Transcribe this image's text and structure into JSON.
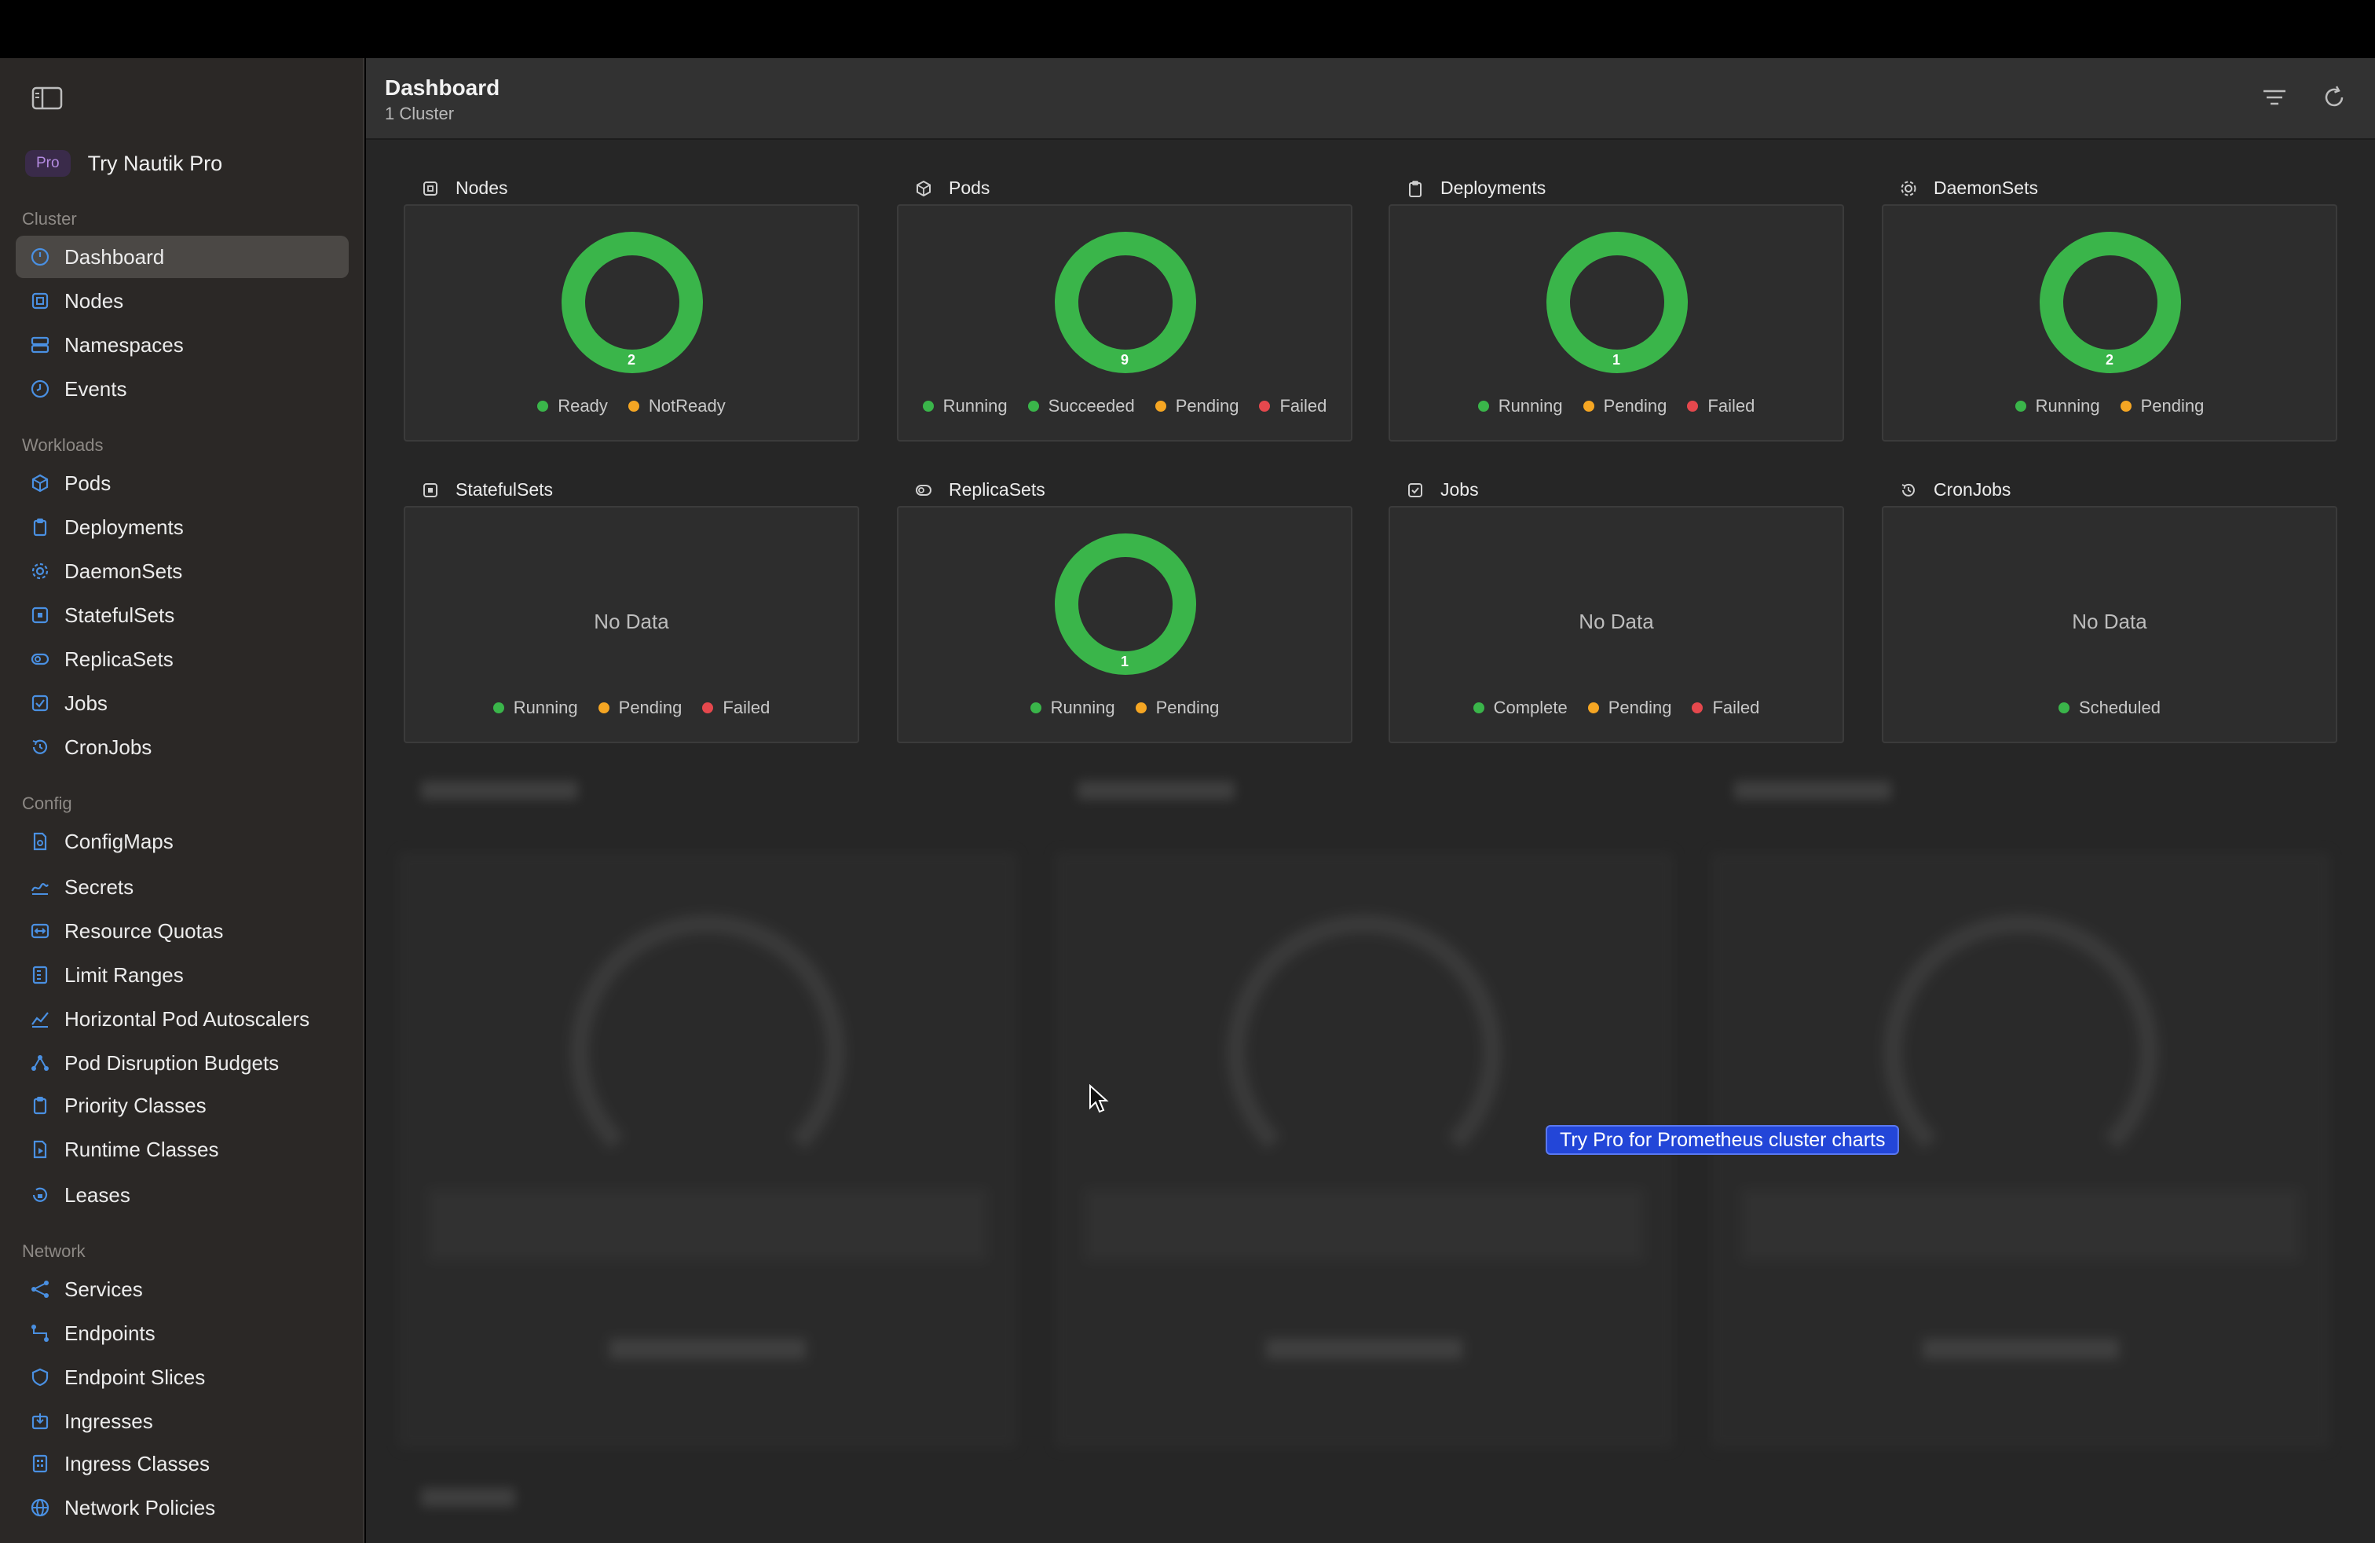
{
  "sidebar": {
    "pro_badge": "Pro",
    "pro_text": "Try Nautik Pro",
    "sections": {
      "cluster": "Cluster",
      "workloads": "Workloads",
      "config": "Config",
      "network": "Network"
    },
    "items": {
      "dashboard": "Dashboard",
      "nodes": "Nodes",
      "namespaces": "Namespaces",
      "events": "Events",
      "pods": "Pods",
      "deployments": "Deployments",
      "daemonsets": "DaemonSets",
      "statefulsets": "StatefulSets",
      "replicasets": "ReplicaSets",
      "jobs": "Jobs",
      "cronjobs": "CronJobs",
      "configmaps": "ConfigMaps",
      "secrets": "Secrets",
      "resource_quotas": "Resource Quotas",
      "limit_ranges": "Limit Ranges",
      "hpa": "Horizontal Pod Autoscalers",
      "pdb": "Pod Disruption Budgets",
      "priority_classes": "Priority Classes",
      "runtime_classes": "Runtime Classes",
      "leases": "Leases",
      "services": "Services",
      "endpoints": "Endpoints",
      "endpoint_slices": "Endpoint Slices",
      "ingresses": "Ingresses",
      "ingress_classes": "Ingress Classes",
      "network_policies": "Network Policies"
    },
    "active": "dashboard"
  },
  "header": {
    "title": "Dashboard",
    "subtitle": "1 Cluster"
  },
  "colors": {
    "green": "#3ab54a",
    "orange": "#f5a623",
    "red": "#e5484d",
    "accent_blue": "#2346d8"
  },
  "cards": {
    "nodes": {
      "title": "Nodes",
      "count": "2",
      "legend": [
        "Ready",
        "NotReady"
      ]
    },
    "pods": {
      "title": "Pods",
      "count": "9",
      "legend": [
        "Running",
        "Succeeded",
        "Pending",
        "Failed"
      ]
    },
    "deployments": {
      "title": "Deployments",
      "count": "1",
      "legend": [
        "Running",
        "Pending",
        "Failed"
      ]
    },
    "daemonsets": {
      "title": "DaemonSets",
      "count": "2",
      "legend": [
        "Running",
        "Pending"
      ]
    },
    "statefulsets": {
      "title": "StatefulSets",
      "nodata": "No Data",
      "legend": [
        "Running",
        "Pending",
        "Failed"
      ]
    },
    "replicasets": {
      "title": "ReplicaSets",
      "count": "1",
      "legend": [
        "Running",
        "Pending"
      ]
    },
    "jobs": {
      "title": "Jobs",
      "nodata": "No Data",
      "legend": [
        "Complete",
        "Pending",
        "Failed"
      ]
    },
    "cronjobs": {
      "title": "CronJobs",
      "nodata": "No Data",
      "legend": [
        "Scheduled"
      ]
    }
  },
  "pro_banner": "Try Pro for Prometheus cluster charts"
}
